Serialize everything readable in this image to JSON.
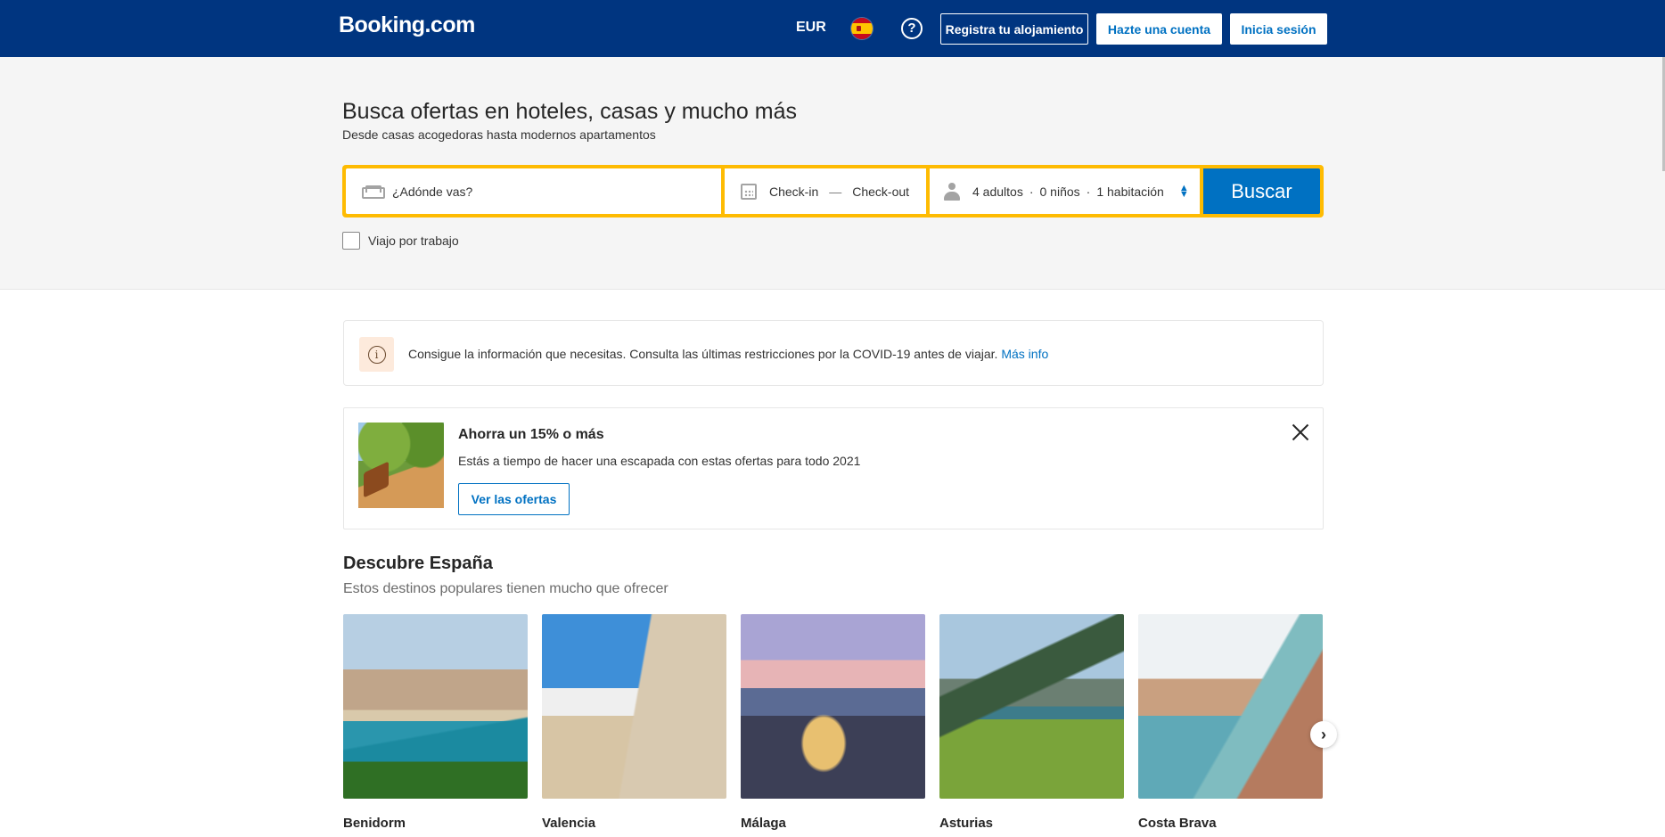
{
  "header": {
    "logo": "Booking.com",
    "currency": "EUR",
    "help": "?",
    "register_property": "Registra tu alojamiento",
    "create_account": "Hazte una cuenta",
    "sign_in": "Inicia sesión"
  },
  "hero": {
    "title": "Busca ofertas en hoteles, casas y mucho más",
    "subtitle": "Desde casas acogedoras hasta modernos apartamentos",
    "search": {
      "destination_placeholder": "¿Adónde vas?",
      "checkin": "Check-in",
      "dash": "—",
      "checkout": "Check-out",
      "adults": "4 adultos",
      "children": "0 niños",
      "rooms": "1 habitación",
      "dot": "·",
      "button": "Buscar"
    },
    "work_trip": "Viajo por trabajo"
  },
  "covid": {
    "text": "Consigue la información que necesitas. Consulta las últimas restricciones por la COVID-19 antes de viajar.",
    "link": "Más info"
  },
  "promo": {
    "title": "Ahorra un 15% o más",
    "text": "Estás a tiempo de hacer una escapada con estas ofertas para todo 2021",
    "button": "Ver las ofertas"
  },
  "discover": {
    "title": "Descubre España",
    "subtitle": "Estos destinos populares tienen mucho que ofrecer",
    "destinations": [
      {
        "name": "Benidorm"
      },
      {
        "name": "Valencia"
      },
      {
        "name": "Málaga"
      },
      {
        "name": "Asturias"
      },
      {
        "name": "Costa Brava"
      }
    ]
  },
  "colors": {
    "brand": "#003580",
    "accent": "#0071c2",
    "search_border": "#febb02"
  }
}
